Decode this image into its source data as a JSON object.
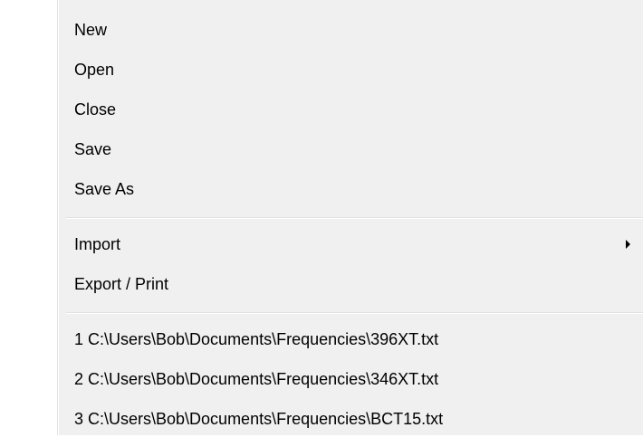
{
  "menu": {
    "file_items": [
      {
        "label": "New"
      },
      {
        "label": "Open"
      },
      {
        "label": "Close"
      },
      {
        "label": "Save"
      },
      {
        "label": "Save As"
      }
    ],
    "transfer_items": [
      {
        "label": "Import",
        "has_submenu": true
      },
      {
        "label": "Export / Print"
      }
    ],
    "recent_files": [
      {
        "label": "1 C:\\Users\\Bob\\Documents\\Frequencies\\396XT.txt"
      },
      {
        "label": "2 C:\\Users\\Bob\\Documents\\Frequencies\\346XT.txt"
      },
      {
        "label": "3 C:\\Users\\Bob\\Documents\\Frequencies\\BCT15.txt"
      }
    ]
  },
  "icons": {
    "submenu_arrow": "triangle-right"
  },
  "colors": {
    "menu_background": "#f0f0f0",
    "gutter": "#ffffff",
    "separator": "#e0e0e0",
    "text": "#000000"
  }
}
